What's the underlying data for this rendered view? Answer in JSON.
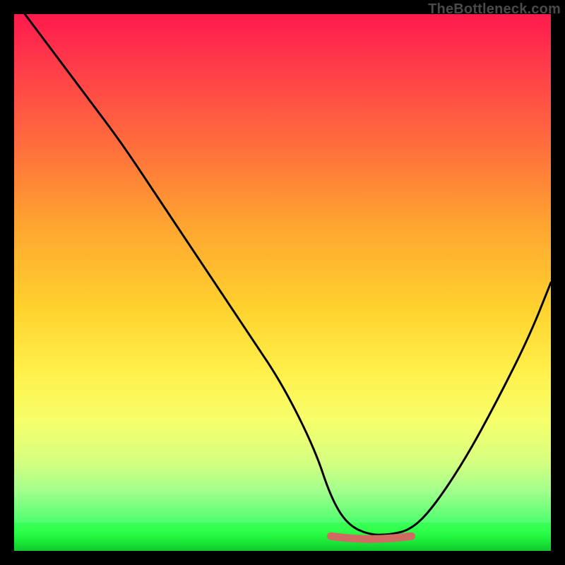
{
  "watermark": "TheBottleneck.com",
  "colors": {
    "frame": "#000000",
    "curve": "#000000",
    "marker": "#d06a62",
    "gradient_top": "#ff1a4d",
    "gradient_bottom": "#0fc82e"
  },
  "chart_data": {
    "type": "line",
    "title": "",
    "xlabel": "",
    "ylabel": "",
    "xlim": [
      0,
      100
    ],
    "ylim": [
      0,
      100
    ],
    "grid": false,
    "legend": false,
    "series": [
      {
        "name": "bottleneck-curve",
        "x": [
          2,
          8,
          14,
          20,
          26,
          32,
          38,
          44,
          50,
          56,
          59,
          62,
          66,
          70,
          74,
          78,
          84,
          90,
          96,
          100
        ],
        "y": [
          100,
          92,
          84,
          76,
          67,
          58,
          49,
          40,
          31,
          19,
          10,
          5,
          3,
          3,
          4,
          8,
          17,
          28,
          40,
          50
        ]
      }
    ],
    "markers": [
      {
        "name": "flat-minimum",
        "x_start": 59,
        "x_end": 74,
        "y": 3
      }
    ],
    "background_gradient": {
      "orientation": "vertical",
      "stops": [
        {
          "pos": 0.0,
          "color": "#ff1a4d"
        },
        {
          "pos": 0.25,
          "color": "#ff6b3d"
        },
        {
          "pos": 0.58,
          "color": "#ffd22e"
        },
        {
          "pos": 0.8,
          "color": "#f7ff6b"
        },
        {
          "pos": 0.95,
          "color": "#4fff6e"
        },
        {
          "pos": 1.0,
          "color": "#0fc82e"
        }
      ]
    }
  }
}
